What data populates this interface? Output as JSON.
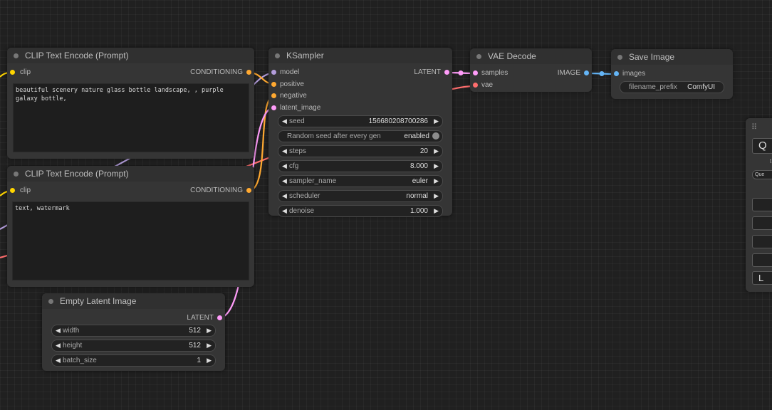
{
  "colors": {
    "clip": "#ffd500",
    "conditioning": "#ffa931",
    "model": "#b39ddb",
    "latent": "#ff9cf9",
    "vae": "#ff6e6e",
    "image": "#64b5f6"
  },
  "nodes": {
    "clip_pos": {
      "title": "CLIP Text Encode (Prompt)",
      "input": "clip",
      "output": "CONDITIONING",
      "text": "beautiful scenery nature glass bottle landscape, , purple galaxy bottle,"
    },
    "clip_neg": {
      "title": "CLIP Text Encode (Prompt)",
      "input": "clip",
      "output": "CONDITIONING",
      "text": "text, watermark"
    },
    "ksampler": {
      "title": "KSampler",
      "inputs": [
        "model",
        "positive",
        "negative",
        "latent_image"
      ],
      "output": "LATENT",
      "widgets": [
        {
          "name": "seed",
          "value": "156680208700286"
        },
        {
          "name": "Random seed after every gen",
          "value": "enabled",
          "toggle": true
        },
        {
          "name": "steps",
          "value": "20"
        },
        {
          "name": "cfg",
          "value": "8.000"
        },
        {
          "name": "sampler_name",
          "value": "euler"
        },
        {
          "name": "scheduler",
          "value": "normal"
        },
        {
          "name": "denoise",
          "value": "1.000"
        }
      ]
    },
    "vae_decode": {
      "title": "VAE Decode",
      "inputs": [
        "samples",
        "vae"
      ],
      "output": "IMAGE"
    },
    "save_image": {
      "title": "Save Image",
      "input": "images",
      "widget": {
        "name": "filename_prefix",
        "value": "ComfyUI"
      }
    },
    "empty_latent": {
      "title": "Empty Latent Image",
      "output": "LATENT",
      "widgets": [
        {
          "name": "width",
          "value": "512"
        },
        {
          "name": "height",
          "value": "512"
        },
        {
          "name": "batch_size",
          "value": "1"
        }
      ]
    }
  },
  "panel": {
    "grip": "⠿",
    "queue_label": "Q",
    "small_text": "t",
    "queue_front": "Que",
    "last_btn": "L"
  }
}
